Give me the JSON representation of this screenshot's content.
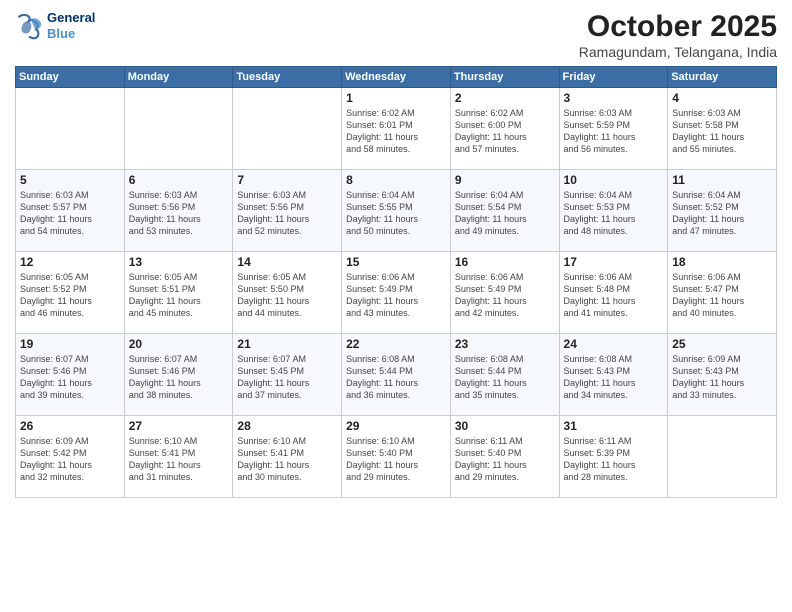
{
  "logo": {
    "line1": "General",
    "line2": "Blue"
  },
  "title": "October 2025",
  "subtitle": "Ramagundam, Telangana, India",
  "weekdays": [
    "Sunday",
    "Monday",
    "Tuesday",
    "Wednesday",
    "Thursday",
    "Friday",
    "Saturday"
  ],
  "weeks": [
    [
      {
        "day": "",
        "info": ""
      },
      {
        "day": "",
        "info": ""
      },
      {
        "day": "",
        "info": ""
      },
      {
        "day": "1",
        "info": "Sunrise: 6:02 AM\nSunset: 6:01 PM\nDaylight: 11 hours\nand 58 minutes."
      },
      {
        "day": "2",
        "info": "Sunrise: 6:02 AM\nSunset: 6:00 PM\nDaylight: 11 hours\nand 57 minutes."
      },
      {
        "day": "3",
        "info": "Sunrise: 6:03 AM\nSunset: 5:59 PM\nDaylight: 11 hours\nand 56 minutes."
      },
      {
        "day": "4",
        "info": "Sunrise: 6:03 AM\nSunset: 5:58 PM\nDaylight: 11 hours\nand 55 minutes."
      }
    ],
    [
      {
        "day": "5",
        "info": "Sunrise: 6:03 AM\nSunset: 5:57 PM\nDaylight: 11 hours\nand 54 minutes."
      },
      {
        "day": "6",
        "info": "Sunrise: 6:03 AM\nSunset: 5:56 PM\nDaylight: 11 hours\nand 53 minutes."
      },
      {
        "day": "7",
        "info": "Sunrise: 6:03 AM\nSunset: 5:56 PM\nDaylight: 11 hours\nand 52 minutes."
      },
      {
        "day": "8",
        "info": "Sunrise: 6:04 AM\nSunset: 5:55 PM\nDaylight: 11 hours\nand 50 minutes."
      },
      {
        "day": "9",
        "info": "Sunrise: 6:04 AM\nSunset: 5:54 PM\nDaylight: 11 hours\nand 49 minutes."
      },
      {
        "day": "10",
        "info": "Sunrise: 6:04 AM\nSunset: 5:53 PM\nDaylight: 11 hours\nand 48 minutes."
      },
      {
        "day": "11",
        "info": "Sunrise: 6:04 AM\nSunset: 5:52 PM\nDaylight: 11 hours\nand 47 minutes."
      }
    ],
    [
      {
        "day": "12",
        "info": "Sunrise: 6:05 AM\nSunset: 5:52 PM\nDaylight: 11 hours\nand 46 minutes."
      },
      {
        "day": "13",
        "info": "Sunrise: 6:05 AM\nSunset: 5:51 PM\nDaylight: 11 hours\nand 45 minutes."
      },
      {
        "day": "14",
        "info": "Sunrise: 6:05 AM\nSunset: 5:50 PM\nDaylight: 11 hours\nand 44 minutes."
      },
      {
        "day": "15",
        "info": "Sunrise: 6:06 AM\nSunset: 5:49 PM\nDaylight: 11 hours\nand 43 minutes."
      },
      {
        "day": "16",
        "info": "Sunrise: 6:06 AM\nSunset: 5:49 PM\nDaylight: 11 hours\nand 42 minutes."
      },
      {
        "day": "17",
        "info": "Sunrise: 6:06 AM\nSunset: 5:48 PM\nDaylight: 11 hours\nand 41 minutes."
      },
      {
        "day": "18",
        "info": "Sunrise: 6:06 AM\nSunset: 5:47 PM\nDaylight: 11 hours\nand 40 minutes."
      }
    ],
    [
      {
        "day": "19",
        "info": "Sunrise: 6:07 AM\nSunset: 5:46 PM\nDaylight: 11 hours\nand 39 minutes."
      },
      {
        "day": "20",
        "info": "Sunrise: 6:07 AM\nSunset: 5:46 PM\nDaylight: 11 hours\nand 38 minutes."
      },
      {
        "day": "21",
        "info": "Sunrise: 6:07 AM\nSunset: 5:45 PM\nDaylight: 11 hours\nand 37 minutes."
      },
      {
        "day": "22",
        "info": "Sunrise: 6:08 AM\nSunset: 5:44 PM\nDaylight: 11 hours\nand 36 minutes."
      },
      {
        "day": "23",
        "info": "Sunrise: 6:08 AM\nSunset: 5:44 PM\nDaylight: 11 hours\nand 35 minutes."
      },
      {
        "day": "24",
        "info": "Sunrise: 6:08 AM\nSunset: 5:43 PM\nDaylight: 11 hours\nand 34 minutes."
      },
      {
        "day": "25",
        "info": "Sunrise: 6:09 AM\nSunset: 5:43 PM\nDaylight: 11 hours\nand 33 minutes."
      }
    ],
    [
      {
        "day": "26",
        "info": "Sunrise: 6:09 AM\nSunset: 5:42 PM\nDaylight: 11 hours\nand 32 minutes."
      },
      {
        "day": "27",
        "info": "Sunrise: 6:10 AM\nSunset: 5:41 PM\nDaylight: 11 hours\nand 31 minutes."
      },
      {
        "day": "28",
        "info": "Sunrise: 6:10 AM\nSunset: 5:41 PM\nDaylight: 11 hours\nand 30 minutes."
      },
      {
        "day": "29",
        "info": "Sunrise: 6:10 AM\nSunset: 5:40 PM\nDaylight: 11 hours\nand 29 minutes."
      },
      {
        "day": "30",
        "info": "Sunrise: 6:11 AM\nSunset: 5:40 PM\nDaylight: 11 hours\nand 29 minutes."
      },
      {
        "day": "31",
        "info": "Sunrise: 6:11 AM\nSunset: 5:39 PM\nDaylight: 11 hours\nand 28 minutes."
      },
      {
        "day": "",
        "info": ""
      }
    ]
  ]
}
